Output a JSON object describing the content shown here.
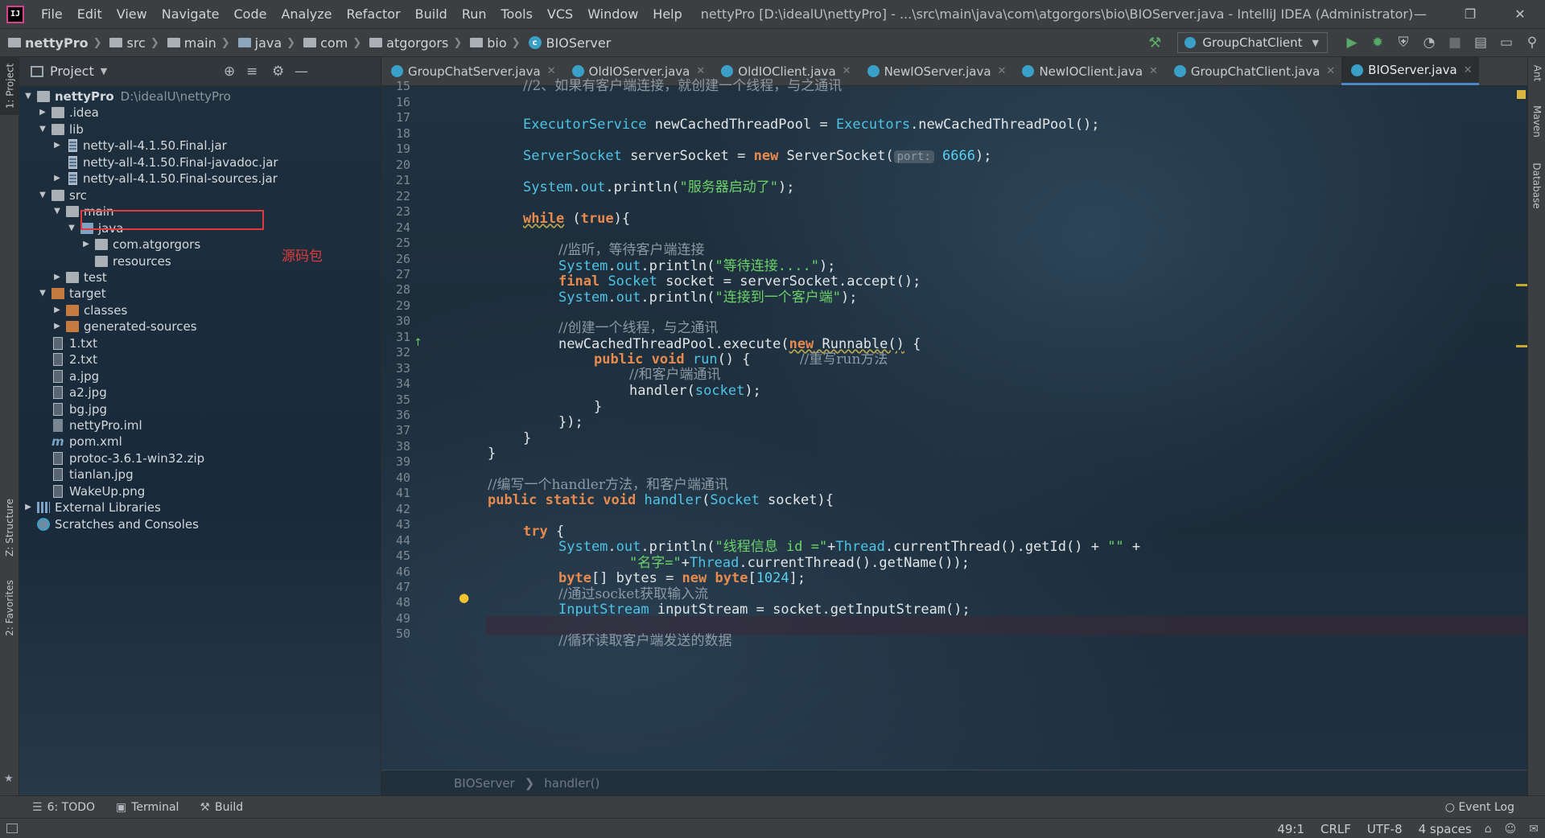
{
  "menubar": {
    "items": [
      "File",
      "Edit",
      "View",
      "Navigate",
      "Code",
      "Analyze",
      "Refactor",
      "Build",
      "Run",
      "Tools",
      "VCS",
      "Window",
      "Help"
    ],
    "window_title": "nettyPro [D:\\idealU\\nettyPro] - ...\\src\\main\\java\\com\\atgorgors\\bio\\BIOServer.java - IntelliJ IDEA (Administrator)",
    "app_icon": "IJ"
  },
  "navbar": {
    "crumbs": [
      "nettyPro",
      "src",
      "main",
      "java",
      "com",
      "atgorgors",
      "bio",
      "BIOServer"
    ],
    "run_config": "GroupChatClient"
  },
  "project": {
    "title": "Project",
    "tree": [
      {
        "label": "nettyPro",
        "path": "D:\\idealU\\nettyPro",
        "depth": 0,
        "arrow": "open",
        "icon": "folder"
      },
      {
        "label": ".idea",
        "depth": 1,
        "arrow": "closed",
        "icon": "folder"
      },
      {
        "label": "lib",
        "depth": 1,
        "arrow": "open",
        "icon": "folder"
      },
      {
        "label": "netty-all-4.1.50.Final.jar",
        "depth": 2,
        "arrow": "closed",
        "icon": "jar"
      },
      {
        "label": "netty-all-4.1.50.Final-javadoc.jar",
        "depth": 2,
        "arrow": "none",
        "icon": "jar"
      },
      {
        "label": "netty-all-4.1.50.Final-sources.jar",
        "depth": 2,
        "arrow": "closed",
        "icon": "jar"
      },
      {
        "label": "src",
        "depth": 1,
        "arrow": "open",
        "icon": "folder"
      },
      {
        "label": "main",
        "depth": 2,
        "arrow": "open",
        "icon": "folder"
      },
      {
        "label": "java",
        "depth": 3,
        "arrow": "open",
        "icon": "folder-blue"
      },
      {
        "label": "com.atgorgors",
        "depth": 4,
        "arrow": "closed",
        "icon": "folder-pkg"
      },
      {
        "label": "resources",
        "depth": 4,
        "arrow": "none",
        "icon": "folder"
      },
      {
        "label": "test",
        "depth": 2,
        "arrow": "closed",
        "icon": "folder"
      },
      {
        "label": "target",
        "depth": 1,
        "arrow": "open",
        "icon": "folder-orange"
      },
      {
        "label": "classes",
        "depth": 2,
        "arrow": "closed",
        "icon": "folder-orange"
      },
      {
        "label": "generated-sources",
        "depth": 2,
        "arrow": "closed",
        "icon": "folder-orange"
      },
      {
        "label": "1.txt",
        "depth": 1,
        "arrow": "none",
        "icon": "file"
      },
      {
        "label": "2.txt",
        "depth": 1,
        "arrow": "none",
        "icon": "file"
      },
      {
        "label": "a.jpg",
        "depth": 1,
        "arrow": "none",
        "icon": "file"
      },
      {
        "label": "a2.jpg",
        "depth": 1,
        "arrow": "none",
        "icon": "file"
      },
      {
        "label": "bg.jpg",
        "depth": 1,
        "arrow": "none",
        "icon": "file"
      },
      {
        "label": "nettyPro.iml",
        "depth": 1,
        "arrow": "none",
        "icon": "iml"
      },
      {
        "label": "pom.xml",
        "depth": 1,
        "arrow": "none",
        "icon": "maven"
      },
      {
        "label": "protoc-3.6.1-win32.zip",
        "depth": 1,
        "arrow": "none",
        "icon": "file"
      },
      {
        "label": "tianlan.jpg",
        "depth": 1,
        "arrow": "none",
        "icon": "file"
      },
      {
        "label": "WakeUp.png",
        "depth": 1,
        "arrow": "none",
        "icon": "file"
      },
      {
        "label": "External Libraries",
        "depth": 0,
        "arrow": "closed",
        "icon": "libs"
      },
      {
        "label": "Scratches and Consoles",
        "depth": 0,
        "arrow": "none",
        "icon": "scratch"
      }
    ],
    "annotation": "源码包"
  },
  "left_stripe": {
    "project_tab": "1: Project",
    "structure_tab": "Z: Structure",
    "favorites_tab": "2: Favorites"
  },
  "right_stripe": {
    "ant_tab": "Ant",
    "maven_tab": "Maven",
    "database_tab": "Database"
  },
  "tabs": [
    {
      "label": "GroupChatServer.java",
      "active": false
    },
    {
      "label": "OldIOServer.java",
      "active": false
    },
    {
      "label": "OldIOClient.java",
      "active": false
    },
    {
      "label": "NewIOServer.java",
      "active": false
    },
    {
      "label": "NewIOClient.java",
      "active": false
    },
    {
      "label": "GroupChatClient.java",
      "active": false
    },
    {
      "label": "BIOServer.java",
      "active": true
    }
  ],
  "editor": {
    "first_line": 15,
    "line_numbers": [
      15,
      16,
      17,
      18,
      19,
      20,
      21,
      22,
      23,
      24,
      25,
      26,
      27,
      28,
      29,
      30,
      31,
      32,
      33,
      34,
      35,
      36,
      37,
      38,
      39,
      40,
      41,
      42,
      43,
      44,
      45,
      46,
      47,
      48,
      49,
      50
    ],
    "current_line": 49,
    "breadcrumb": [
      "BIOServer",
      "handler()"
    ]
  },
  "bottom_tools": {
    "todo": "6: TODO",
    "terminal": "Terminal",
    "build": "Build",
    "event_log": "Event Log"
  },
  "status": {
    "position": "49:1",
    "line_sep": "CRLF",
    "encoding": "UTF-8",
    "indent": "4 spaces"
  }
}
